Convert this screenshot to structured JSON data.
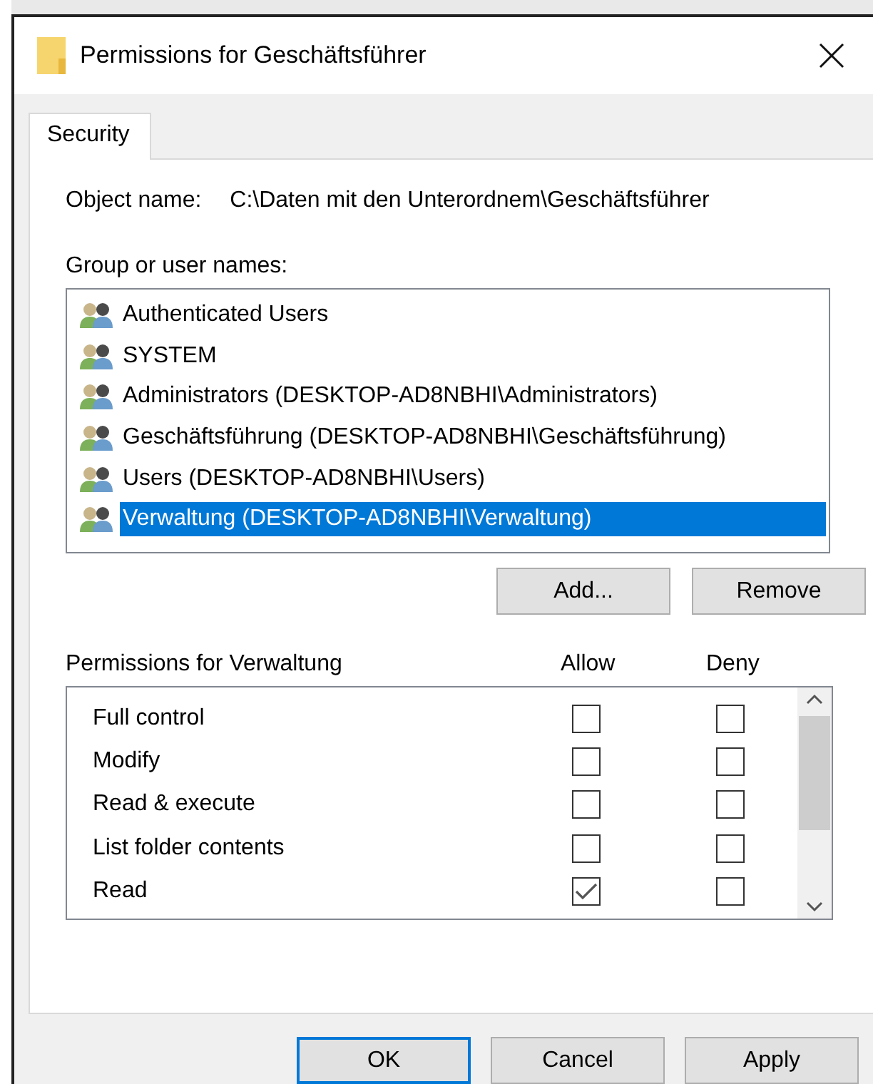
{
  "window": {
    "title": "Permissions for Geschäftsführer"
  },
  "tabs": [
    {
      "label": "Security",
      "selected": true
    }
  ],
  "object_name": {
    "label": "Object name:",
    "value": "C:\\Daten mit den Unterordnem\\Geschäftsführer"
  },
  "group_label": "Group or user names:",
  "users": [
    {
      "name": "Authenticated Users",
      "selected": false
    },
    {
      "name": "SYSTEM",
      "selected": false
    },
    {
      "name": "Administrators (DESKTOP-AD8NBHI\\Administrators)",
      "selected": false
    },
    {
      "name": "Geschäftsführung (DESKTOP-AD8NBHI\\Geschäftsführung)",
      "selected": false
    },
    {
      "name": "Users (DESKTOP-AD8NBHI\\Users)",
      "selected": false
    },
    {
      "name": "Verwaltung (DESKTOP-AD8NBHI\\Verwaltung)",
      "selected": true
    }
  ],
  "user_buttons": [
    "Add...",
    "Remove"
  ],
  "permissions": {
    "label": "Permissions for Verwaltung",
    "allow_header": "Allow",
    "deny_header": "Deny",
    "rows": [
      {
        "name": "Full control",
        "allow": false,
        "deny": false
      },
      {
        "name": "Modify",
        "allow": false,
        "deny": false
      },
      {
        "name": "Read & execute",
        "allow": false,
        "deny": false
      },
      {
        "name": "List folder contents",
        "allow": false,
        "deny": false
      },
      {
        "name": "Read",
        "allow": true,
        "deny": false
      }
    ]
  },
  "dialog_buttons": [
    {
      "label": "OK",
      "default": true
    },
    {
      "label": "Cancel",
      "default": false
    },
    {
      "label": "Apply",
      "default": false
    }
  ]
}
